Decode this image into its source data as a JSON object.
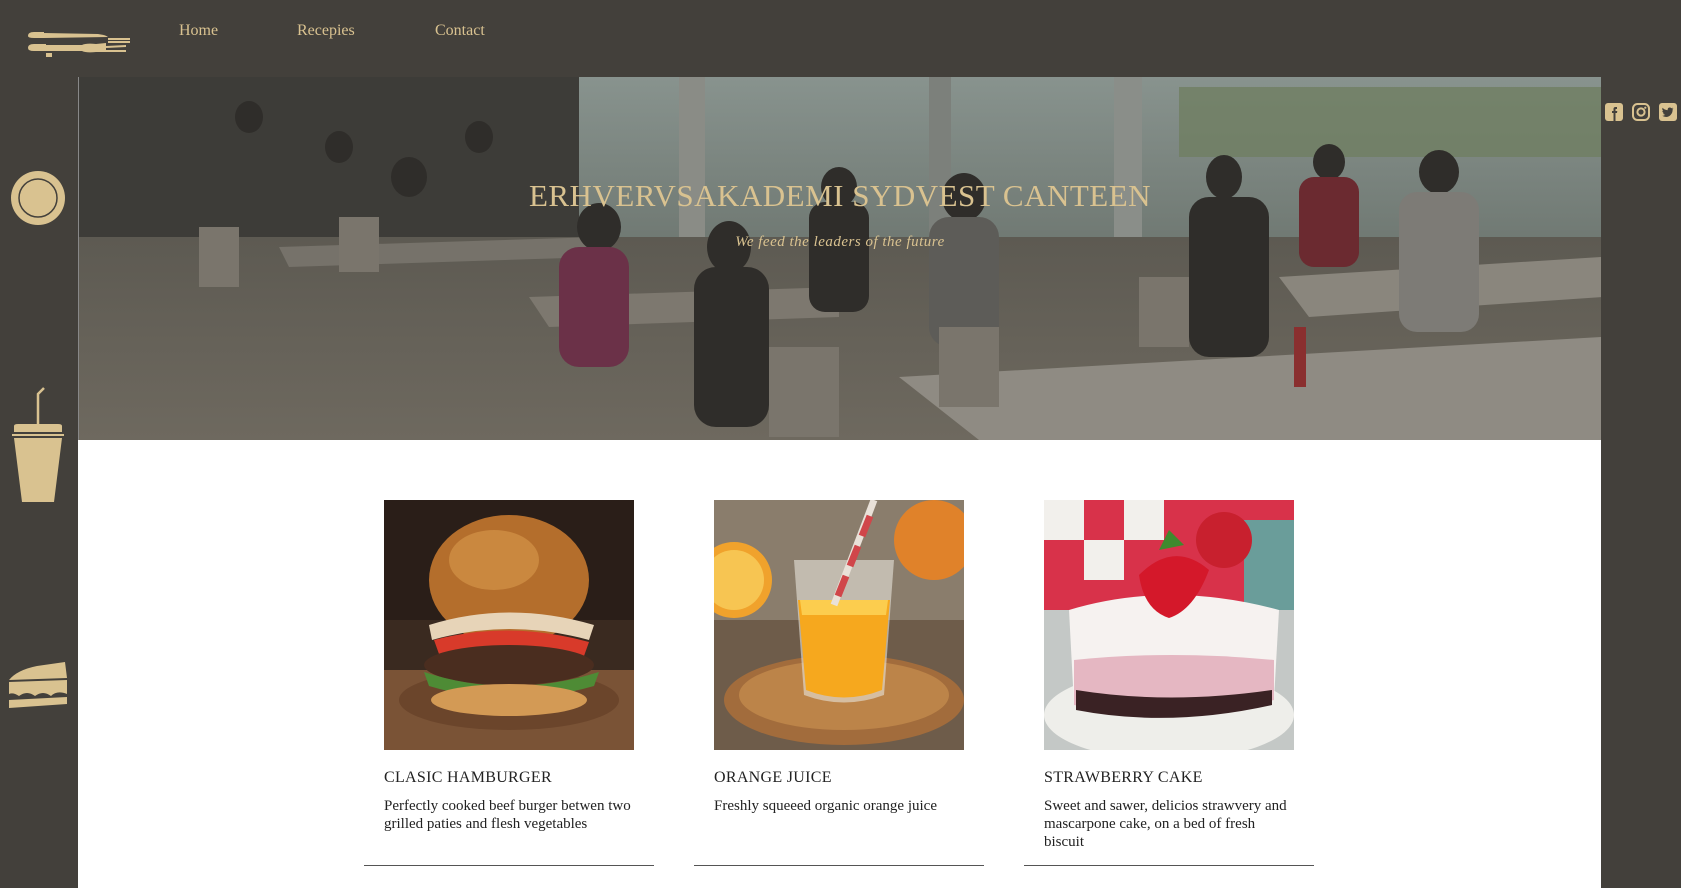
{
  "nav": {
    "links": [
      {
        "label": "Home"
      },
      {
        "label": "Recepies"
      },
      {
        "label": "Contact"
      }
    ]
  },
  "sidebar": {
    "icons": [
      "plate-icon",
      "drink-cup-icon",
      "cake-slice-icon"
    ]
  },
  "hero": {
    "title": "ERHVERVSAKADEMI SYDVEST CANTEEN",
    "subtitle": "We feed the leaders of the future"
  },
  "social": {
    "icons": [
      "facebook-icon",
      "instagram-icon",
      "twitter-icon"
    ]
  },
  "cards": [
    {
      "name": "CLASIC HAMBURGER",
      "description": "Perfectly cooked beef burger betwen two grilled paties and flesh vegetables"
    },
    {
      "name": "ORANGE JUICE",
      "description": "Freshly squeeed organic orange juice"
    },
    {
      "name": "STRAWBERRY CAKE",
      "description": "Sweet and sawer, delicios strawvery and mascarpone cake, on a bed of fresh biscuit"
    }
  ],
  "colors": {
    "background": "#43403b",
    "accent": "#d9c290",
    "content_bg": "#ffffff",
    "text": "#222222"
  }
}
